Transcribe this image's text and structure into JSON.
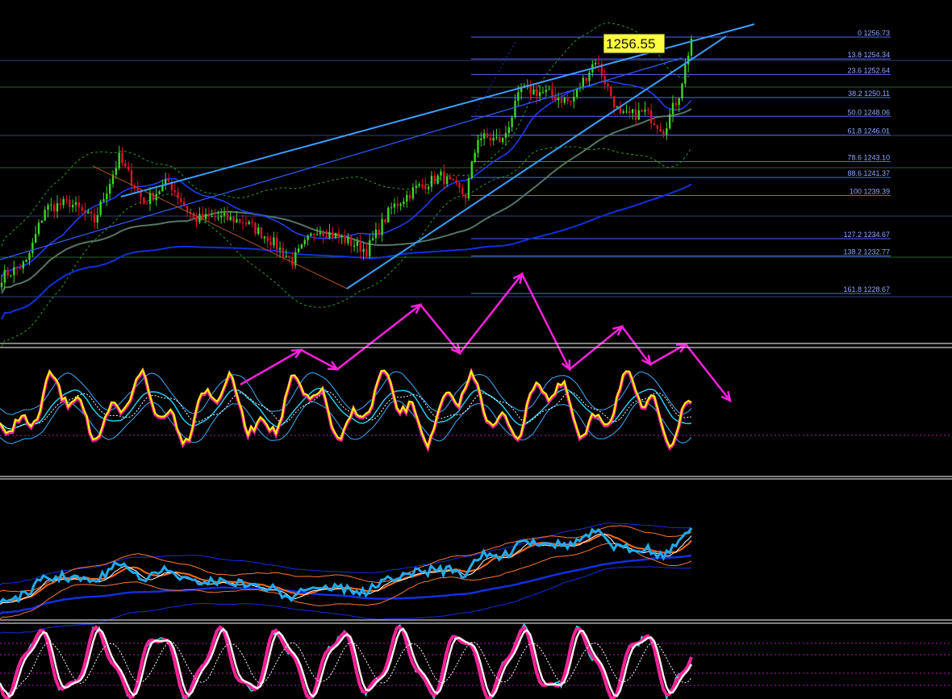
{
  "colors": {
    "background": "#000000",
    "bull_candle": "#3fd628",
    "bear_candle": "#e0102a",
    "fib_line": "#5566ff",
    "trendline": "#3aa0ff",
    "annotation_arrow": "#ff22dd",
    "osc_main": "#ffee00",
    "osc_outline": "#ff2299",
    "osc_bands": "#3ab0ff",
    "rsi_line": "#22aaee",
    "ma_orange": "#ff6a10",
    "ma_blue": "#1030e0",
    "ma_gray": "#557766",
    "stoch_pink": "#ff2299",
    "stoch_white": "#ffeeee",
    "stoch_cyan": "#22e8ee",
    "panel_separator": "#cccccc",
    "price_tag_bg": "#ffff40"
  },
  "price_tag": {
    "label": "1256.55",
    "value": 1256.55
  },
  "chart_data": {
    "type": "line",
    "title": "",
    "instrument_series": "candlestick price",
    "xlabel": "",
    "ylabel": "",
    "ylim": [
      1224,
      1262
    ],
    "grid": false,
    "fibonacci_levels": [
      {
        "ratio": "0",
        "price": "1256.73",
        "label": "0 1256.73"
      },
      {
        "ratio": "13.8",
        "price": "1254.34",
        "label": "13.8 1254.34"
      },
      {
        "ratio": "23.6",
        "price": "1252.64",
        "label": "23.6 1252.64"
      },
      {
        "ratio": "38.2",
        "price": "1250.11",
        "label": "38.2 1250.11"
      },
      {
        "ratio": "50.0",
        "price": "1248.06",
        "label": "50.0 1248.06"
      },
      {
        "ratio": "61.8",
        "price": "1246.01",
        "label": "61.8 1246.01"
      },
      {
        "ratio": "78.6",
        "price": "1243.10",
        "label": "78.6 1243.10"
      },
      {
        "ratio": "88.6",
        "price": "1241.37",
        "label": "88.6 1241.37"
      },
      {
        "ratio": "100",
        "price": "1239.39",
        "label": "100 1239.39"
      },
      {
        "ratio": "127.2",
        "price": "1234.67",
        "label": "127.2 1234.67"
      },
      {
        "ratio": "138.2",
        "price": "1232.77",
        "label": "138.2 1232.77"
      },
      {
        "ratio": "161.8",
        "price": "1228.67",
        "label": "161.8 1228.67"
      }
    ],
    "price_path_keypoints": [
      {
        "bar": 0,
        "price": 1230.5
      },
      {
        "bar": 8,
        "price": 1232.0
      },
      {
        "bar": 14,
        "price": 1238.0
      },
      {
        "bar": 22,
        "price": 1238.6
      },
      {
        "bar": 30,
        "price": 1236.6
      },
      {
        "bar": 38,
        "price": 1243.5
      },
      {
        "bar": 46,
        "price": 1238.6
      },
      {
        "bar": 54,
        "price": 1240.9
      },
      {
        "bar": 62,
        "price": 1236.8
      },
      {
        "bar": 70,
        "price": 1237.0
      },
      {
        "bar": 78,
        "price": 1236.6
      },
      {
        "bar": 86,
        "price": 1234.8
      },
      {
        "bar": 94,
        "price": 1232.2
      },
      {
        "bar": 102,
        "price": 1235.8
      },
      {
        "bar": 110,
        "price": 1234.7
      },
      {
        "bar": 118,
        "price": 1233.4
      },
      {
        "bar": 126,
        "price": 1238.0
      },
      {
        "bar": 134,
        "price": 1240.2
      },
      {
        "bar": 142,
        "price": 1241.5
      },
      {
        "bar": 150,
        "price": 1239.4
      },
      {
        "bar": 154,
        "price": 1245.8
      },
      {
        "bar": 162,
        "price": 1245.4
      },
      {
        "bar": 168,
        "price": 1251.0
      },
      {
        "bar": 176,
        "price": 1250.6
      },
      {
        "bar": 184,
        "price": 1249.6
      },
      {
        "bar": 192,
        "price": 1254.3
      },
      {
        "bar": 200,
        "price": 1248.0
      },
      {
        "bar": 208,
        "price": 1248.5
      },
      {
        "bar": 214,
        "price": 1246.6
      },
      {
        "bar": 219,
        "price": 1250.5
      },
      {
        "bar": 223,
        "price": 1256.55
      }
    ],
    "bars": 224,
    "annotations": [
      "zigzag forecast arrows (magenta)",
      "rising trend channel (blue)",
      "fibonacci retracement/extension levels"
    ],
    "indicator_panels": [
      {
        "name": "",
        "type": "oscillator with bands"
      },
      {
        "name": "",
        "type": "RSI with moving averages"
      },
      {
        "name": "",
        "type": "stochastic"
      }
    ]
  }
}
